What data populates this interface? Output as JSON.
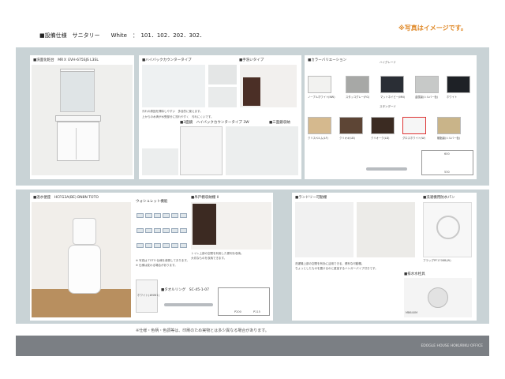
{
  "header": {
    "title": "■設備仕様　サニタリー　　White　：　101．102．202．302．",
    "photo_note": "※写真はイメージです。"
  },
  "vanity": {
    "main_label": "■洗面化粧台　MRＸ EVH-675SJS L3SL",
    "counter_label": "■ハイバックカウンタータイプ",
    "sink_label": "■手洗いタイプ",
    "mirror_label": "■3面鏡　ハイバックカウンタータイプ 3W",
    "storage_label": "■三面鏡収納",
    "counter_desc": "汚れの原因を掃除しやすい　多目的に使えます。",
    "counter_desc2": "上からの水滴が水受部分に流れやすく　汚れにくいです。",
    "color_title": "■カラーバリエーション",
    "high_grade": "ハイグレード",
    "std_grade": "スタンダード",
    "colors": [
      {
        "name": "ノーブルホワイト(NW)",
        "color": "#f2f2f0"
      },
      {
        "name": "スタッコグレー(FG)",
        "color": "#a7a8a6"
      },
      {
        "name": "マットネイビー(MN)",
        "color": "#2a2e35"
      },
      {
        "name": "金属製(シルバー色)",
        "color": "#c7c9c8"
      },
      {
        "name": "ホワイト",
        "color": "#1e2126"
      },
      {
        "name": "クリスペルム(LF)",
        "color": "#d5b98e"
      },
      {
        "name": "クリオキ(LB)",
        "color": "#5d4535"
      },
      {
        "name": "クリオーク(LD)",
        "color": "#3b2b22"
      },
      {
        "name": "グロスホワイト(W)",
        "color": "#f6f6f6"
      },
      {
        "name": "樹脂製(シルバー色)",
        "color": "#c9b489"
      }
    ],
    "dims": [
      "600",
      "530"
    ]
  },
  "toilet": {
    "main_label": "■温水便座　HCFG3A(BE) BN8N  TOTO",
    "washlet_label": "ウォシュレット機能",
    "washlet_features": [
      "脱臭",
      "おしり",
      "ビデ",
      "ムーブ",
      "マッサージ",
      "乾燥",
      "便座",
      "節電",
      "オート"
    ],
    "washlet_note1": "※ 写真は TOTO 仕様を参照しております。",
    "washlet_note2": "※ 仕様は変わる場合があります。",
    "upper_cabinet_label": "■吊戸棚収納棚 II",
    "upper_cabinet_desc": "トイレ上部の空間を利用した便利な収納。",
    "upper_cabinet_desc2": "大切なものを収納できます。",
    "paper_holder_label": "■タオルリング　SC-45-1-07",
    "remote_note": "ホワイト(#NW1)",
    "dims": [
      "P200",
      "P115"
    ]
  },
  "laundry": {
    "label": "■ランドリー可動棚",
    "desc": "洗濯機上部の空間を有効に活用できる、便利な可動棚。",
    "desc2": "ちょっとしたものを置けるのに重宝するハンガーパイプ付きです。",
    "pan_label": "■洗濯機用防水パン",
    "pan_model": "ブラッグPF1708B(W)",
    "drain_label": "■排水水栓具",
    "drain_model": "MB640M"
  },
  "notes": {
    "bottom": "※仕様・色柄・色調等は、印刷のため実物とは多少異なる場合があります。"
  },
  "footer": {
    "company": "EDOGLE HOUSE HOKURIKU OFFICE"
  }
}
